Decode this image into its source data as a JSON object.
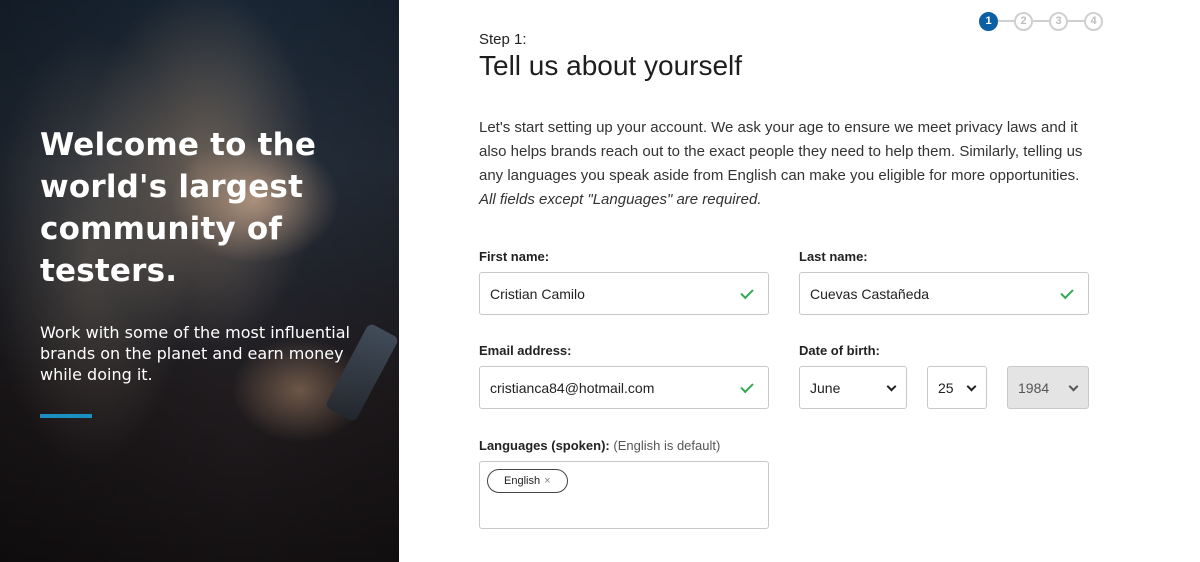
{
  "hero": {
    "title": "Welcome to the world's largest community of testers.",
    "subtitle": "Work with some of the most influential brands on the planet and earn money while doing it.",
    "accent_color": "#1a8fc2"
  },
  "stepper": {
    "steps": [
      "1",
      "2",
      "3",
      "4"
    ],
    "current_step": 1,
    "active_color": "#0b5fa5"
  },
  "form": {
    "step_label": "Step 1:",
    "title": "Tell us about yourself",
    "intro": "Let's start setting up your account. We ask your age to ensure we meet privacy laws and it also helps brands reach out to the exact people they need to help them. Similarly, telling us any languages you speak aside from English can make you eligible for more opportunities.",
    "intro_note": "All fields except \"Languages\" are required.",
    "first_name": {
      "label": "First name:",
      "value": "Cristian Camilo",
      "valid_icon": "check-icon"
    },
    "last_name": {
      "label": "Last name:",
      "value": "Cuevas Castañeda",
      "valid_icon": "check-icon"
    },
    "email": {
      "label": "Email address:",
      "value": "cristianca84@hotmail.com",
      "valid_icon": "check-icon"
    },
    "dob": {
      "label": "Date of birth:",
      "month": "June",
      "day": "25",
      "year": "1984"
    },
    "languages": {
      "label": "Languages (spoken):",
      "hint": "(English is default)",
      "tags": [
        {
          "label": "English",
          "remove_icon": "×"
        }
      ]
    },
    "valid_color": "#35a853"
  }
}
